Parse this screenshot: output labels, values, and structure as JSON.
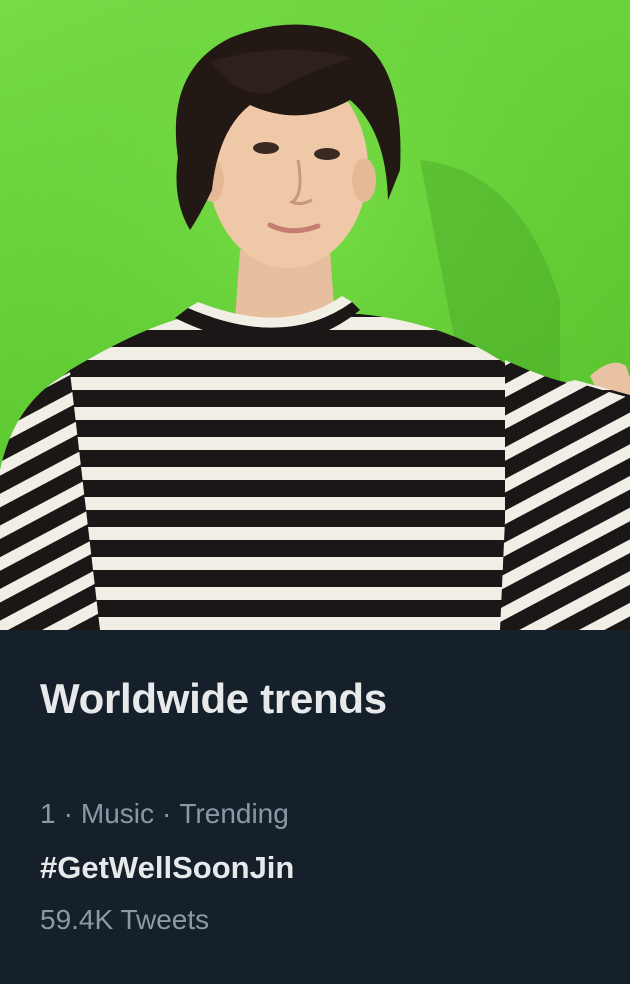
{
  "hero": {
    "image": "trend-photo",
    "colors": {
      "background": "#62cf33",
      "stripe_dark": "#1a1716",
      "stripe_light": "#f1eee6"
    }
  },
  "panel": {
    "title": "Worldwide trends",
    "background": "#15202b"
  },
  "trend": {
    "rank": "1",
    "separator": "·",
    "category": "Music",
    "status": "Trending",
    "name": "#GetWellSoonJin",
    "tweet_count": "59.4K Tweets"
  }
}
